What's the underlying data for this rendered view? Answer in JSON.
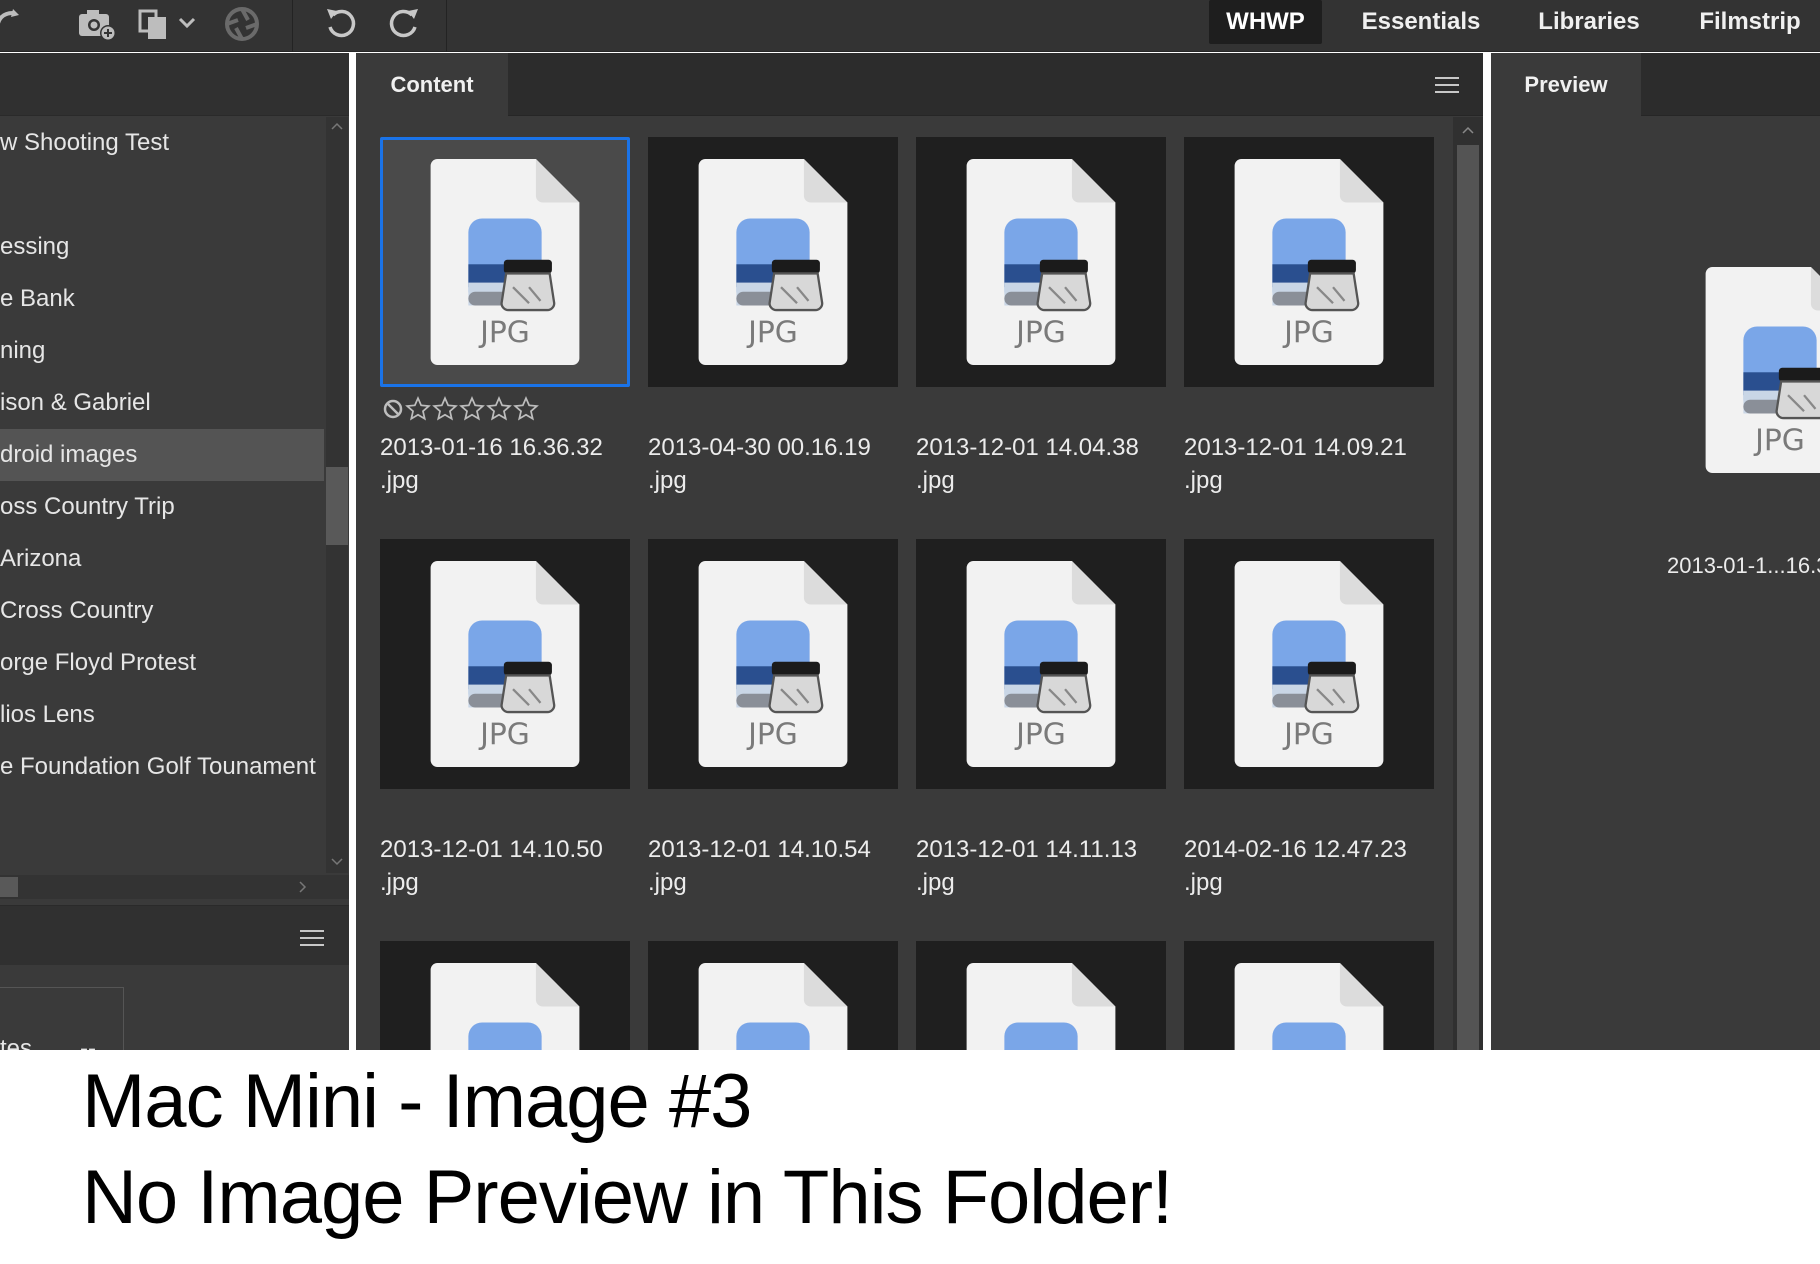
{
  "toolbar": {
    "workspaces": [
      {
        "label": "WHWP",
        "active": true
      },
      {
        "label": "Essentials",
        "active": false
      },
      {
        "label": "Libraries",
        "active": false
      },
      {
        "label": "Filmstrip",
        "active": false
      }
    ],
    "icons": [
      "boomerang-icon",
      "camera-import-icon",
      "copy-dropdown-icon",
      "aperture-icon",
      "rotate-left-icon",
      "rotate-right-icon"
    ]
  },
  "folders": {
    "items": [
      {
        "label": "w Shooting Test",
        "selected": false
      },
      {
        "label": "",
        "selected": false
      },
      {
        "label": "essing",
        "selected": false
      },
      {
        "label": "e Bank",
        "selected": false
      },
      {
        "label": "ning",
        "selected": false
      },
      {
        "label": "ison & Gabriel",
        "selected": false
      },
      {
        "label": "droid images",
        "selected": true
      },
      {
        "label": "oss Country Trip",
        "selected": false
      },
      {
        "label": "Arizona",
        "selected": false
      },
      {
        "label": "Cross Country",
        "selected": false
      },
      {
        "label": "orge Floyd Protest",
        "selected": false
      },
      {
        "label": "lios Lens",
        "selected": false
      },
      {
        "label": "e Foundation Golf Tounament",
        "selected": false
      },
      {
        "label": "",
        "selected": false
      }
    ]
  },
  "filter": {
    "row_label": "tes",
    "row_value": "--"
  },
  "content": {
    "tab_label": "Content",
    "thumbnail_badge": "JPG",
    "files": [
      {
        "name": "2013-01-16 16.36.32\n.jpg",
        "selected": true
      },
      {
        "name": "2013-04-30 00.16.19\n.jpg",
        "selected": false
      },
      {
        "name": "2013-12-01 14.04.38\n.jpg",
        "selected": false
      },
      {
        "name": "2013-12-01 14.09.21\n.jpg",
        "selected": false
      },
      {
        "name": "2013-12-01 14.10.50\n.jpg",
        "selected": false
      },
      {
        "name": "2013-12-01 14.10.54\n.jpg",
        "selected": false
      },
      {
        "name": "2013-12-01 14.11.13\n.jpg",
        "selected": false
      },
      {
        "name": "2014-02-16 12.47.23\n.jpg",
        "selected": false
      },
      {
        "name": "",
        "selected": false
      },
      {
        "name": "",
        "selected": false
      },
      {
        "name": "",
        "selected": false
      },
      {
        "name": "",
        "selected": false
      }
    ],
    "selected_rating": "0 stars"
  },
  "preview": {
    "tab_label": "Preview",
    "badge": "JPG",
    "file_name": "2013-01-1...16.3"
  },
  "caption": {
    "line1": "Mac Mini - Image #3",
    "line2": "No Image Preview in This Folder!"
  }
}
